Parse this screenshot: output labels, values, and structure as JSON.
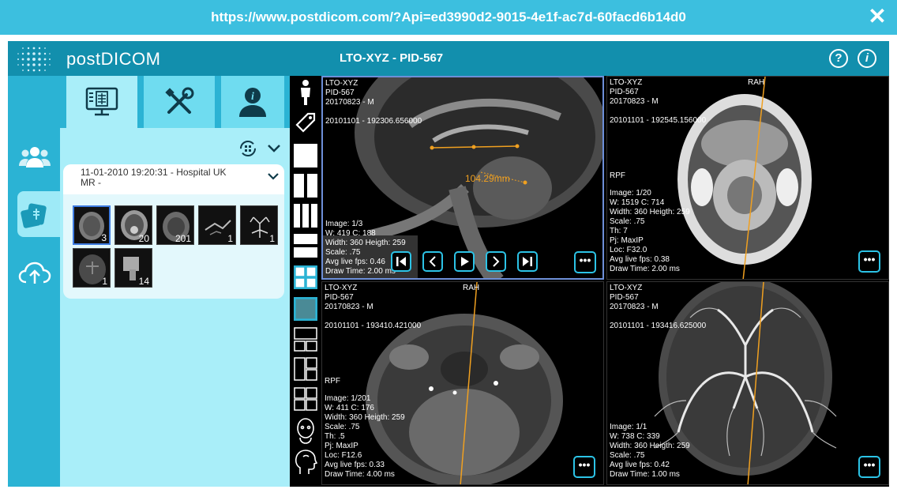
{
  "browser": {
    "url": "https://www.postdicom.com/?Api=ed3990d2-9015-4e1f-ac7d-60facd6b14d0",
    "close_label": "✕"
  },
  "app": {
    "logo": "postDICOM",
    "title": "LTO-XYZ - PID-567",
    "help_label": "?",
    "info_label": "i"
  },
  "left_nav": [
    "users-icon",
    "series-icon",
    "upload-icon"
  ],
  "panel": {
    "tabs": [
      "viewer-tab-icon",
      "tools-tab-icon",
      "patient-info-tab-icon"
    ],
    "study": {
      "date_line": "11-01-2010 19:20:31 - Hospital UK",
      "modality_line": "MR -"
    },
    "thumbnails": [
      {
        "count": "3",
        "selected": true
      },
      {
        "count": "20"
      },
      {
        "count": "201"
      },
      {
        "count": "1"
      },
      {
        "count": "1"
      },
      {
        "count": "1"
      },
      {
        "count": "14"
      }
    ]
  },
  "viewports": [
    {
      "top": [
        "LTO-XYZ",
        "PID-567",
        "20170823 - M",
        "",
        "20101101 - 192306.656000"
      ],
      "bottom": [
        "Image: 1/3",
        "W: 419 C: 188",
        "Width: 360 Heigth: 259",
        "Scale: .75",
        "Avg live fps: 0.46",
        "Draw Time: 2.00 ms"
      ],
      "measurement": "104.29mm",
      "orient": "",
      "side": ""
    },
    {
      "top": [
        "LTO-XYZ",
        "PID-567",
        "20170823 - M",
        "",
        "20101101 - 192545.156000"
      ],
      "bottom": [
        "Image: 1/20",
        "W: 1519 C: 714",
        "Width: 360 Heigth: 259",
        "Scale: .75",
        "Th: 7",
        "Pj: MaxIP",
        "Loc: F32.0",
        "Avg live fps: 0.38",
        "Draw Time: 2.00 ms"
      ],
      "orient": "RAH",
      "side": "RPF"
    },
    {
      "top": [
        "LTO-XYZ",
        "PID-567",
        "20170823 - M",
        "",
        "20101101 - 193410.421000"
      ],
      "bottom": [
        "Image: 1/201",
        "W: 411 C: 176",
        "Width: 360 Heigth: 259",
        "Scale: .75",
        "Th: .5",
        "Pj: MaxIP",
        "Loc: F12.6",
        "Avg live fps: 0.33",
        "Draw Time: 4.00 ms"
      ],
      "orient": "RAH",
      "side": "RPF"
    },
    {
      "top": [
        "LTO-XYZ",
        "PID-567",
        "20170823 - M",
        "",
        "20101101 - 193416.625000"
      ],
      "bottom": [
        "Image: 1/1",
        "W: 738 C: 339",
        "Width: 360 Heigth: 259",
        "Scale: .75",
        "Avg live fps: 0.42",
        "Draw Time: 1.00 ms"
      ],
      "orient": "",
      "side": ""
    }
  ],
  "more_label": "•••",
  "colors": {
    "accent": "#3cbfdf",
    "header": "#128fad",
    "panel": "#a9eef9",
    "measure": "#f0a020"
  }
}
